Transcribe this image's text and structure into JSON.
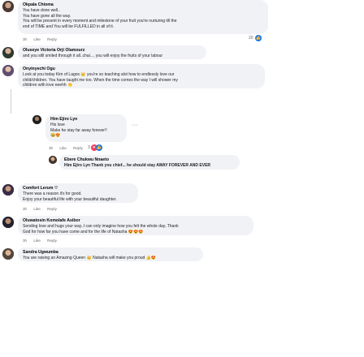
{
  "comments": [
    {
      "author": "Okpala Chioma",
      "lines": [
        "You have done well..",
        "You have gone all the way.",
        "You will be present in every moment and milestone of your fruit you're nurturing till the",
        "end of TIME and You will be FULFILLED in all of it."
      ],
      "actions": {
        "time": "3h",
        "like": "Like",
        "reply": "Reply"
      },
      "reaction_count": "20"
    },
    {
      "author": "Oluseye Victoria Orji Olamourz",
      "lines": [
        "and you still smiled through it all..chai.... you will enjoy the fruits of your labour"
      ]
    },
    {
      "author": "Onyinyechi Ogu",
      "lines": [
        "Look at you today Kim of Lagos 👑 you're so teaching alot how to endlessly love our",
        "child/children. You have taught me too. When the time comes the way I will shower my",
        "children with love eeehh 👏"
      ]
    },
    {
      "author": "Him Ejiro Lyn",
      "lines": [
        "His love",
        "Make he stay far away forever!!",
        "😂😍"
      ],
      "actions": {
        "time": "3h",
        "like": "Like",
        "reply": "Reply"
      },
      "reaction_count": "3",
      "more": "···"
    },
    {
      "author": "Ebere Chukwu Nnaeto",
      "lines": [
        "Him Ejiro Lyn Thank you chief... he should stay AWAY FOREVER AND EVER"
      ]
    },
    {
      "author": "Comfort Lerum ♡",
      "lines": [
        "There was a reason it's for good.",
        "Enjoy your beautiful life with your beautiful daughter."
      ],
      "actions": {
        "time": "3h",
        "like": "Like",
        "reply": "Reply"
      }
    },
    {
      "author": "Oluwatosin Komolafe Asibor",
      "lines": [
        "Sending love and hugs your way..I can only imagine how you felt the whole day..Thank",
        "God for how far you have come and for the life of Natasha 😍😍😍"
      ],
      "actions": {
        "time": "3h",
        "like": "Like",
        "reply": "Reply"
      }
    },
    {
      "author": "Sandra Ugwumba",
      "lines": [
        "You are raising an Amazing Queen 👑 Natasha will make you proud 👍😍"
      ]
    }
  ],
  "colors": {
    "like": "#1877f2",
    "love": "#f33e58",
    "care": "#f7b125",
    "muted": "#65676b",
    "bubble": "#f0f2f5"
  }
}
